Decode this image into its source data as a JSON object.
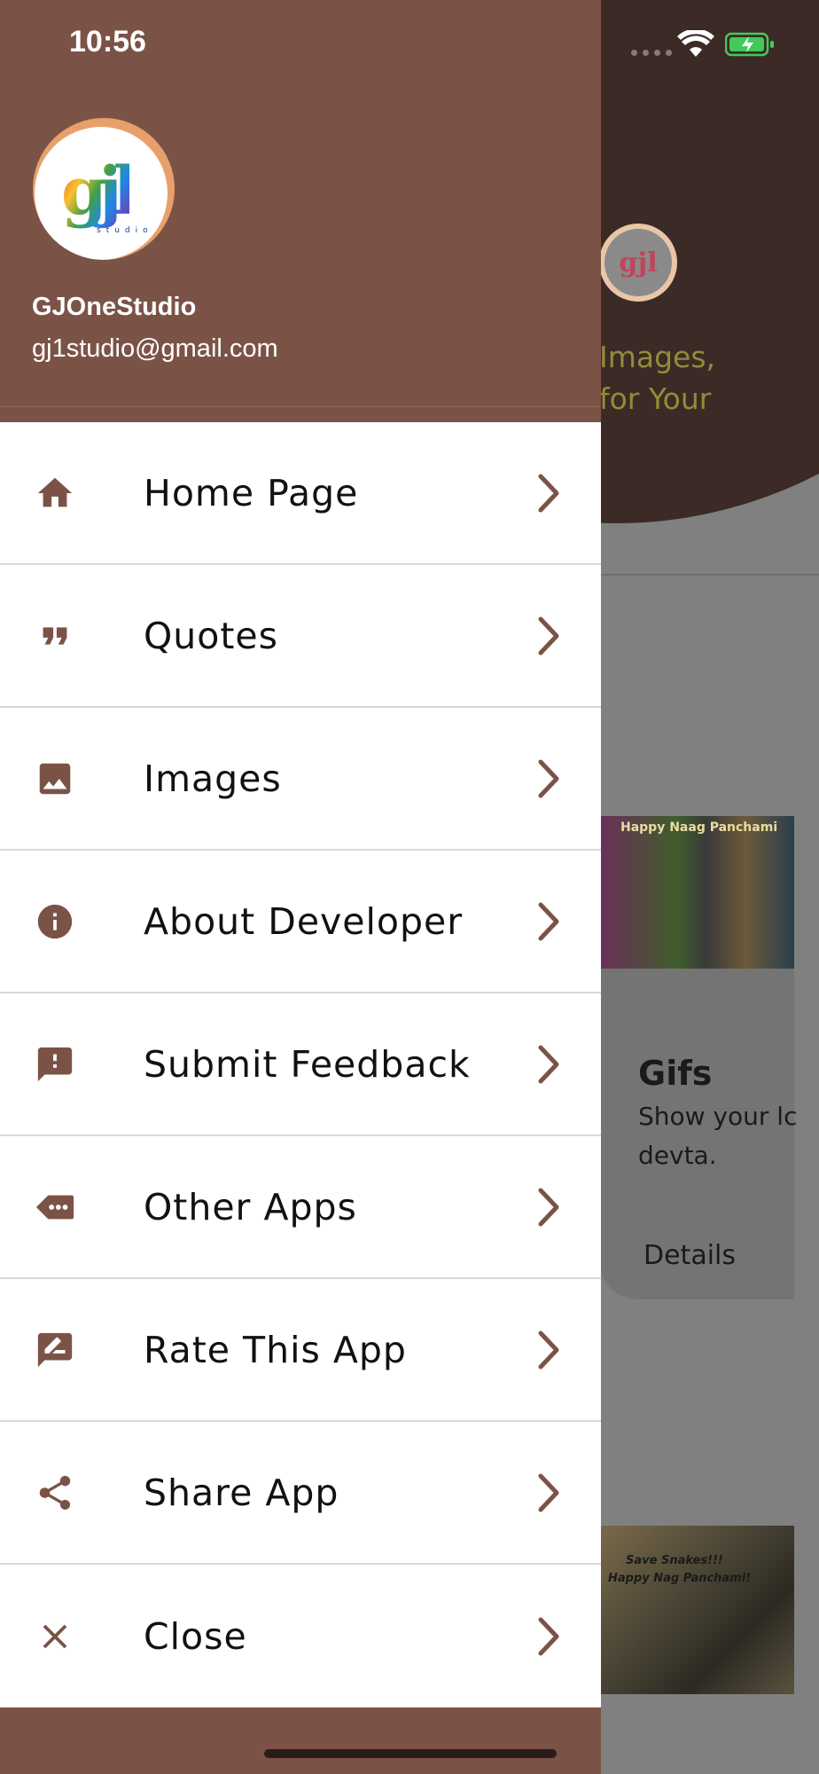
{
  "status_bar": {
    "time": "10:56"
  },
  "drawer": {
    "user": {
      "name": "GJOneStudio",
      "email": "gj1studio@gmail.com"
    },
    "avatar_logo": "gjl",
    "avatar_sub": "studio",
    "menu": [
      {
        "label": "Home Page",
        "icon": "home-icon"
      },
      {
        "label": "Quotes",
        "icon": "quote-icon"
      },
      {
        "label": "Images",
        "icon": "image-icon"
      },
      {
        "label": "About Developer",
        "icon": "info-icon"
      },
      {
        "label": "Submit Feedback",
        "icon": "feedback-icon"
      },
      {
        "label": "Other Apps",
        "icon": "more-apps-icon"
      },
      {
        "label": "Rate This App",
        "icon": "rate-icon"
      },
      {
        "label": "Share App",
        "icon": "share-icon"
      },
      {
        "label": "Close",
        "icon": "close-icon"
      }
    ]
  },
  "background": {
    "tagline_line1": "Images,",
    "tagline_line2": "for Your",
    "image1_caption": "Happy Naag Panchami",
    "card_title": "Gifs",
    "card_desc_line1": "Show your lc",
    "card_desc_line2": "devta.",
    "card_action": "Details",
    "image2_line1": "Save Snakes!!!",
    "image2_line2": "Happy Nag Panchami!"
  },
  "colors": {
    "drawer_header": "#7b5346",
    "icon": "#7b5346",
    "menu_bg": "#ffffff",
    "bg_header": "#3b2a25",
    "tagline": "#8f8d3a"
  }
}
